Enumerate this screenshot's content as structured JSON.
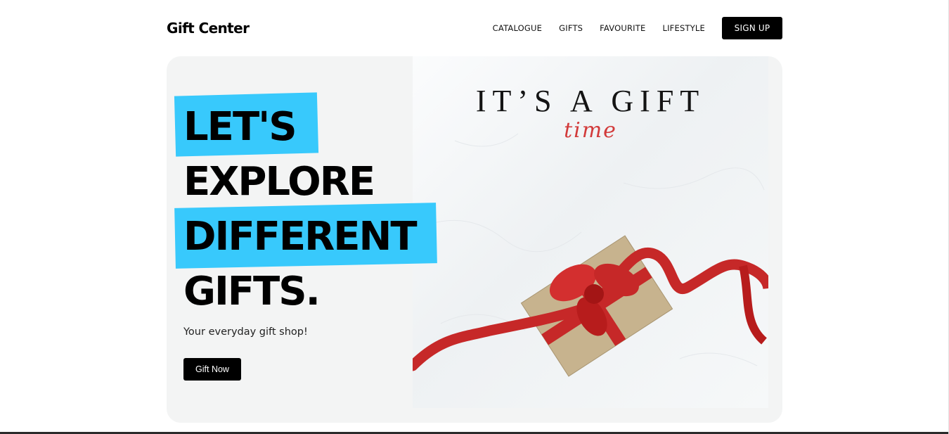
{
  "header": {
    "brand": "Gift Center",
    "nav": [
      "CATALOGUE",
      "GIFTS",
      "FAVOURITE",
      "LIFESTYLE"
    ],
    "signup_label": "SIGN UP"
  },
  "hero": {
    "headline": [
      "LET'S",
      "EXPLORE",
      "DIFFERENT",
      "GIFTS."
    ],
    "tagline": "Your everyday gift shop!",
    "cta_label": "Gift Now",
    "photo_title": "IT’S A GIFT",
    "photo_script": "time"
  },
  "colors": {
    "accent": "#38c9fc",
    "hero_bg": "#f3f4f4",
    "ribbon": "#c62828",
    "button": "#000000"
  }
}
